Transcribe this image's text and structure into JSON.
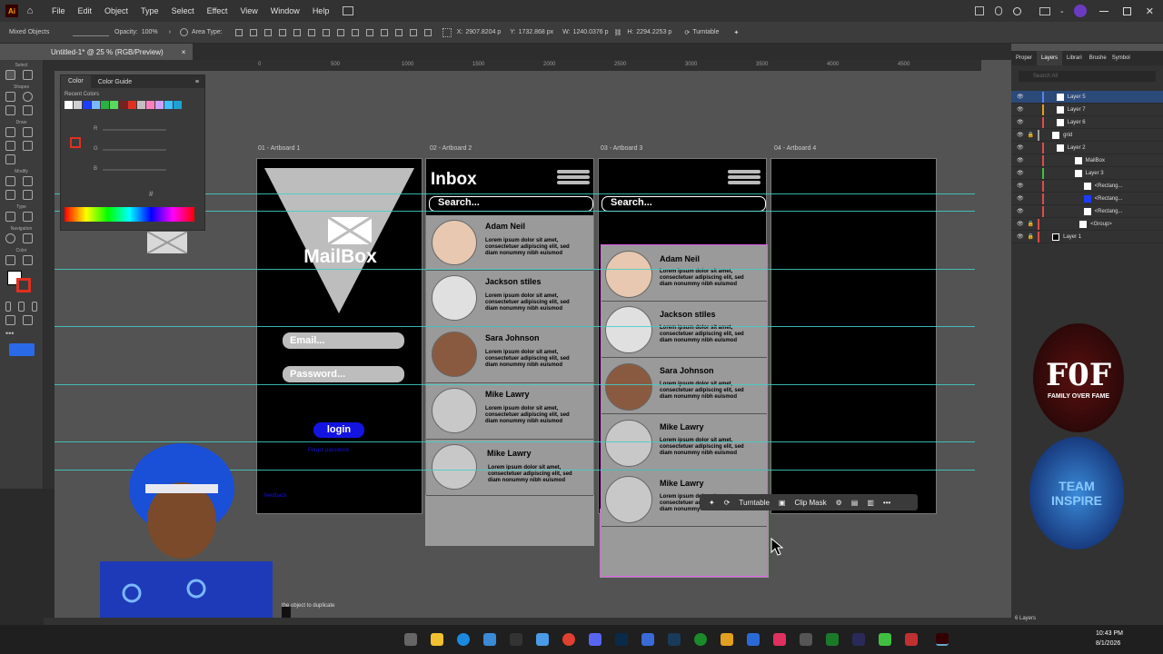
{
  "menubar": {
    "items": [
      "File",
      "Edit",
      "Object",
      "Type",
      "Select",
      "Effect",
      "View",
      "Window",
      "Help"
    ]
  },
  "control_bar": {
    "selection": "Mixed Objects",
    "opacity_label": "Opacity:",
    "opacity_value": "100%",
    "area_type_label": "Area Type:",
    "x_label": "X:",
    "x_value": "2907.8204 p",
    "y_label": "Y:",
    "y_value": "1732.868 px",
    "w_label": "W:",
    "w_value": "1240.0376 p",
    "h_label": "H:",
    "h_value": "2294.2253 p",
    "turntable_label": "Turntable"
  },
  "document_tab": {
    "title": "Untitled-1* @ 25 % (RGB/Preview)",
    "close": "×"
  },
  "toolbar": {
    "labels": [
      "Select",
      "Shapes",
      "Draw",
      "Modify",
      "Type",
      "Navigation",
      "Color"
    ]
  },
  "ruler": {
    "ticks": [
      "0",
      "500",
      "1000",
      "1500",
      "2000",
      "2500",
      "3000",
      "3500",
      "4000",
      "4500"
    ]
  },
  "color_panel": {
    "tab_color": "Color",
    "tab_guide": "Color Guide",
    "recent_label": "Recent Colors",
    "r_label": "R",
    "g_label": "G",
    "b_label": "B",
    "hash": "#",
    "swatches": [
      "#ffffff",
      "#d0d0d0",
      "#1e3cff",
      "#7ab8ff",
      "#2ab040",
      "#5cd65c",
      "#7a2020",
      "#e03020",
      "#c0c0c0",
      "#ff80c0",
      "#d0a0ff",
      "#40c0ff",
      "#20a0d0"
    ]
  },
  "artboards": {
    "ab1": {
      "label": "01 - Artboard 1",
      "brand": "MailBox",
      "email_placeholder": "Email...",
      "password_placeholder": "Password...",
      "login": "login",
      "forgot": "Forgot password",
      "signup": "feedback"
    },
    "ab2": {
      "label": "02 - Artboard 2",
      "title": "Inbox",
      "search": "Search..."
    },
    "ab3": {
      "label": "03 - Artboard 3",
      "search": "Search..."
    },
    "ab4": {
      "label": "04 - Artboard 4"
    }
  },
  "contacts": [
    {
      "name": "Adam Neil",
      "body": "Lorem ipsum dolor sit amet, consectetuer adipiscing elit, sed diam nonummy nibh euismod",
      "photo": true
    },
    {
      "name": "Jackson stiles",
      "body": "Lorem ipsum dolor sit amet, consectetuer adipiscing elit, sed diam nonummy nibh euismod",
      "photo": true
    },
    {
      "name": "Sara Johnson",
      "body": "Lorem ipsum dolor sit amet, consectetuer adipiscing elit, sed diam nonummy nibh euismod",
      "photo": true
    },
    {
      "name": "Mike Lawry",
      "body": "Lorem ipsum dolor sit amet, consectetuer adipiscing elit, sed diam nonummy nibh euismod",
      "photo": false
    },
    {
      "name": "Mike Lawry",
      "body": "Lorem ipsum dolor sit amet, consectetuer adipiscing elit, sed diam nonummy nibh euismod",
      "photo": false
    }
  ],
  "context_bar": {
    "turntable": "Turntable",
    "clip_mask": "Clip Mask",
    "more": "•••"
  },
  "status_bar": {
    "hint": "the object to duplicate"
  },
  "panels": {
    "tabs": [
      "Proper",
      "Layers",
      "Librari",
      "Brushe",
      "Symbol"
    ],
    "search_placeholder": "Search All",
    "layers": [
      {
        "name": "Layer 5",
        "color": "#4f8ae8",
        "indent": 0
      },
      {
        "name": "Layer 7",
        "color": "#e0a020",
        "indent": 0
      },
      {
        "name": "Layer 6",
        "color": "#e04a4a",
        "indent": 0
      },
      {
        "name": "grid",
        "color": "#a0a0a0",
        "indent": 0
      },
      {
        "name": "Layer 2",
        "color": "#e04a4a",
        "indent": 0
      },
      {
        "name": "MailBox",
        "color": "#e04a4a",
        "indent": 1
      },
      {
        "name": "Layer 3",
        "color": "#40c040",
        "indent": 1
      },
      {
        "name": "<Rectang...",
        "color": "#e04a4a",
        "indent": 2
      },
      {
        "name": "<Rectang...",
        "color": "#e04a4a",
        "indent": 2
      },
      {
        "name": "<Rectang...",
        "color": "#e04a4a",
        "indent": 2
      },
      {
        "name": "<Group>",
        "color": "#e04a4a",
        "indent": 2
      },
      {
        "name": "Layer 1",
        "color": "#e04a4a",
        "indent": 0
      }
    ],
    "layer_count": "6 Layers"
  },
  "badges": {
    "logo1_letters": "F0F",
    "logo1_caption": "FAMILY OVER FAME",
    "logo2_line1": "TEAM",
    "logo2_line2": "INSPIRE"
  },
  "taskbar": {
    "time": "10:43 PM",
    "date": "8/1/2026"
  },
  "colors": {
    "accent_blue": "#1414e0",
    "guide": "#3fd0c8",
    "selection": "#e45be9"
  }
}
